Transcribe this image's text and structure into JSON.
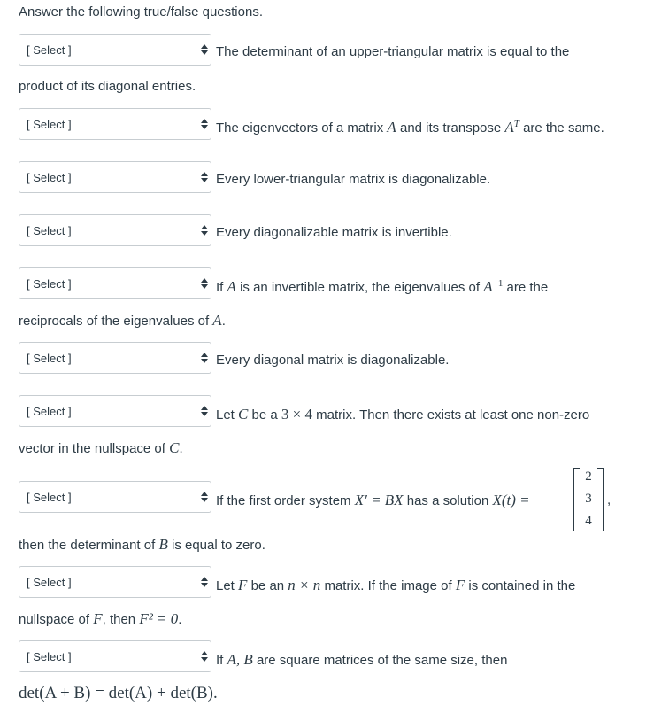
{
  "intro": "Answer the following true/false questions.",
  "select_placeholder": "[ Select ]",
  "icons": {
    "select_arrows": "up-down-arrows-icon"
  },
  "questions": [
    {
      "pre": "The determinant of an upper-triangular matrix is equal to the",
      "cont": "product of its diagonal entries."
    },
    {
      "p1": "The eigenvectors of a matrix ",
      "A": "A",
      "p2": " and its transpose ",
      "AT": "A",
      "T": "T",
      "p3": " are the same."
    },
    {
      "text": "Every lower-triangular matrix is diagonalizable."
    },
    {
      "text": "Every diagonalizable matrix is invertible."
    },
    {
      "p1": "If ",
      "A": "A",
      "p2": " is an invertible matrix, the eigenvalues of ",
      "Ainv": "A",
      "inv": "−1",
      "p3": " are the",
      "cont1": "reciprocals of the eigenvalues of ",
      "cont2": "A",
      "cont3": "."
    },
    {
      "text": "Every diagonal matrix is diagonalizable."
    },
    {
      "p1": "Let ",
      "C": "C",
      "p2": " be a ",
      "dims": "3 × 4",
      "p3": " matrix. Then there exists at least one non-zero",
      "cont1": "vector in the nullspace of ",
      "cont2": "C",
      "cont3": "."
    },
    {
      "p1": "If the first order system ",
      "eq": "X′ = BX",
      "p2": " has a solution ",
      "sol": "X(t) =",
      "vector": [
        "2",
        "3",
        "4"
      ],
      "p3": ",",
      "cont1": "then the determinant of ",
      "cont2": "B",
      "cont3": " is equal to zero."
    },
    {
      "p1": "Let ",
      "F": "F",
      "p2": " be an ",
      "dims": "n × n",
      "p3": " matrix. If the image of ",
      "F2": "F",
      "p4": " is contained in the",
      "cont1": "nullspace of ",
      "cont2": "F",
      "cont3": ", then ",
      "eq": "F² = 0",
      "cont4": "."
    },
    {
      "p1": "If ",
      "AB": "A, B",
      "p2": " are square matrices of the same size, then",
      "cont": "det(A + B) = det(A) + det(B)."
    }
  ]
}
